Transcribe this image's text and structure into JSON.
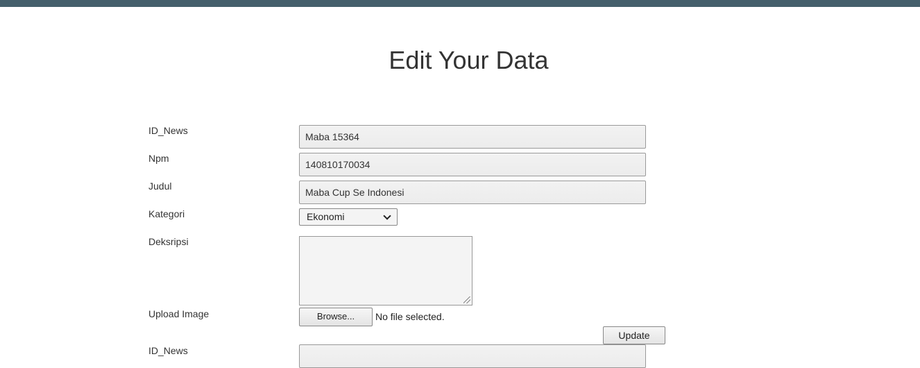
{
  "page": {
    "title": "Edit Your Data"
  },
  "form": {
    "fields": [
      {
        "label": "ID_News",
        "value": "Maba 15364"
      },
      {
        "label": "Npm",
        "value": "140810170034"
      },
      {
        "label": "Judul",
        "value": "Maba Cup Se Indonesi"
      }
    ],
    "kategori": {
      "label": "Kategori",
      "selected": "Ekonomi"
    },
    "deskripsi": {
      "label": "Deksripsi",
      "value": ""
    },
    "upload": {
      "label": "Upload Image",
      "button_label": "Browse...",
      "status": "No file selected."
    },
    "update_label": "Update"
  },
  "next_record": {
    "label": "ID_News"
  },
  "colors": {
    "topbar": "#455f6b"
  }
}
